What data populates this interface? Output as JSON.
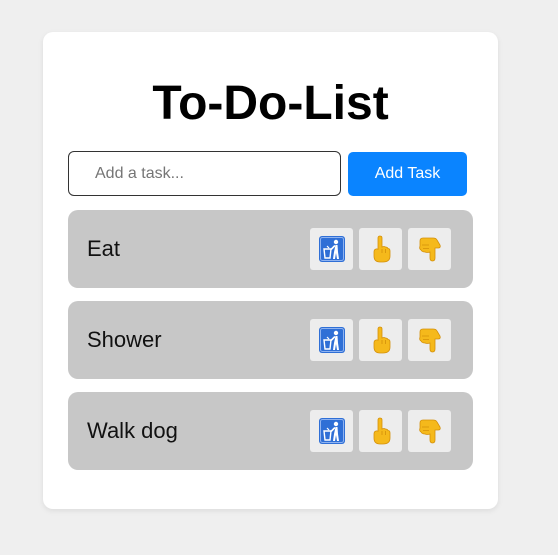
{
  "app": {
    "title": "To-Do-List"
  },
  "input": {
    "placeholder": "Add a task...",
    "value": ""
  },
  "add_button_label": "Add Task",
  "tasks": [
    {
      "label": "Eat"
    },
    {
      "label": "Shower"
    },
    {
      "label": "Walk dog"
    }
  ],
  "actions": [
    {
      "name": "delete",
      "icon": "litter-in-bin-icon"
    },
    {
      "name": "move-up",
      "icon": "pointing-up-icon"
    },
    {
      "name": "move-down",
      "icon": "pointing-down-icon"
    }
  ],
  "colors": {
    "page_background": "#efefef",
    "card_background": "#ffffff",
    "task_background": "#c7c7c7",
    "accent_button": "#0a84ff",
    "action_button_background": "#ededed",
    "trash_icon_blue": "#2f6fd6",
    "hand_icon_yellow": "#f5b91b"
  }
}
